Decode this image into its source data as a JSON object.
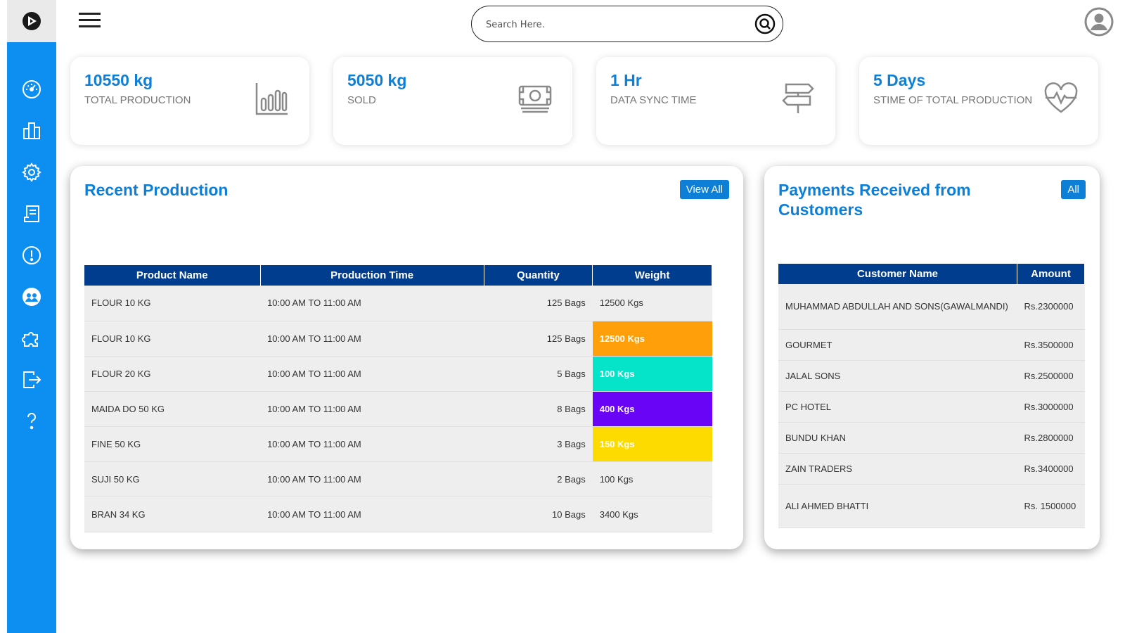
{
  "colors": {
    "accent": "#0d7fd6",
    "sidebar": "#0d8ff2",
    "table_header": "#003d8f"
  },
  "search": {
    "placeholder": "Search Here."
  },
  "stats": [
    {
      "value": "10550 kg",
      "label": "TOTAL PRODUCTION",
      "icon": "bar-chart-icon"
    },
    {
      "value": "5050 kg",
      "label": "SOLD",
      "icon": "money-icon"
    },
    {
      "value": "1 Hr",
      "label": "DATA SYNC TIME",
      "icon": "signpost-icon"
    },
    {
      "value": "5 Days",
      "label": "STIME OF TOTAL PRODUCTION",
      "icon": "heart-pulse-icon"
    }
  ],
  "sidebar": {
    "items": [
      {
        "icon": "dashboard-gauge-icon"
      },
      {
        "icon": "buildings-icon"
      },
      {
        "icon": "settings-gear-icon"
      },
      {
        "icon": "report-icon"
      },
      {
        "icon": "alert-icon"
      },
      {
        "icon": "users-icon"
      },
      {
        "icon": "puzzle-icon"
      },
      {
        "icon": "logout-icon"
      },
      {
        "icon": "help-icon"
      }
    ]
  },
  "recent_production": {
    "title": "Recent Production",
    "button": "View All",
    "columns": [
      "Product Name",
      "Production Time",
      "Quantity",
      "Weight"
    ],
    "rows": [
      {
        "product": "FLOUR 10 KG",
        "time": "10:00 AM TO 11:00 AM",
        "qty": "125 Bags",
        "weight": "12500 Kgs",
        "highlight": ""
      },
      {
        "product": "FLOUR 10 KG",
        "time": "10:00 AM TO 11:00 AM",
        "qty": "125 Bags",
        "weight": "12500 Kgs",
        "highlight": "#ff9f0a"
      },
      {
        "product": "FLOUR 20 KG",
        "time": "10:00 AM TO 11:00 AM",
        "qty": "5 Bags",
        "weight": "100 Kgs",
        "highlight": "#05e4c9"
      },
      {
        "product": "MAIDA DO 50 KG",
        "time": "10:00 AM TO 11:00 AM",
        "qty": "8 Bags",
        "weight": "400 Kgs",
        "highlight": "#6a04f7"
      },
      {
        "product": "FINE 50 KG",
        "time": "10:00 AM TO 11:00 AM",
        "qty": "3 Bags",
        "weight": "150 Kgs",
        "highlight": "#fddb00"
      },
      {
        "product": "SUJI 50 KG",
        "time": "10:00 AM TO 11:00 AM",
        "qty": "2 Bags",
        "weight": "100 Kgs",
        "highlight": ""
      },
      {
        "product": "BRAN 34 KG",
        "time": "10:00 AM TO 11:00 AM",
        "qty": "10 Bags",
        "weight": "3400 Kgs",
        "highlight": ""
      }
    ]
  },
  "payments": {
    "title_line1": "Payments Received from",
    "title_line2": "Customers",
    "button": "All",
    "columns": [
      "Customer Name",
      "Amount"
    ],
    "rows": [
      {
        "customer": "MUHAMMAD ABDULLAH AND SONS(GAWALMANDI)",
        "amount": "Rs.2300000"
      },
      {
        "customer": "GOURMET",
        "amount": "Rs.3500000"
      },
      {
        "customer": "JALAL SONS",
        "amount": "Rs.2500000"
      },
      {
        "customer": "PC HOTEL",
        "amount": "Rs.3000000"
      },
      {
        "customer": "BUNDU KHAN",
        "amount": "Rs.2800000"
      },
      {
        "customer": "ZAIN TRADERS",
        "amount": "Rs.3400000"
      },
      {
        "customer": "ALI AHMED BHATTI",
        "amount": "Rs. 1500000"
      }
    ]
  }
}
